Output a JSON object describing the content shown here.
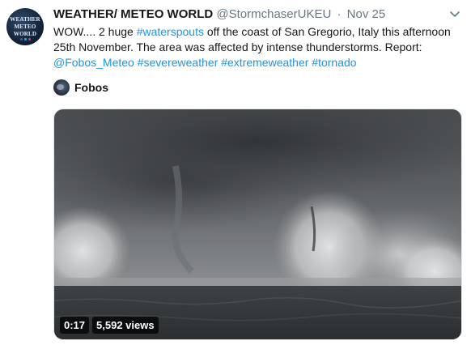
{
  "tweet": {
    "author": {
      "name": "WEATHER/ METEO WORLD",
      "handle": "@StormchaserUKEU",
      "separator": "·",
      "date": "Nov 25",
      "avatar_lines": [
        "WEATHER",
        "METEO",
        "WORLD"
      ],
      "avatar_icon": "weather-meteo-world-logo"
    },
    "menu_icon": "chevron-down-icon",
    "text": {
      "t1": "WOW.... 2 huge ",
      "h1": "#waterspouts",
      "t2": " off the coast of San Gregorio, Italy this afternoon 25th November. The area was affected by intense thunderstorms. Report: ",
      "m1": "@Fobos_Meteo",
      "s1": " ",
      "h2": "#severeweather",
      "s2": " ",
      "h3": "#extremeweather",
      "s3": " ",
      "h4": "#tornado"
    },
    "media_credit": {
      "name": "Fobos",
      "avatar_icon": "fobos-avatar"
    },
    "video": {
      "duration": "0:17",
      "views": "5,592 views"
    },
    "colors": {
      "link": "#1b95e0",
      "secondary_text": "#657786",
      "primary_text": "#14171a"
    }
  }
}
